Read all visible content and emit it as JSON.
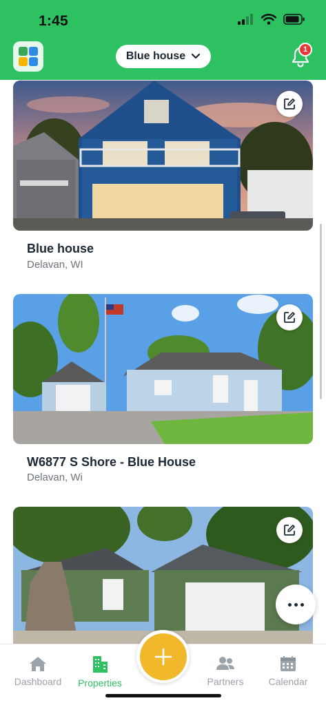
{
  "status_bar": {
    "time": "1:45",
    "icons": [
      "cellular-signal-icon",
      "wifi-icon",
      "battery-icon"
    ]
  },
  "header": {
    "property_selector": "Blue house",
    "notification_count": "1",
    "colors": {
      "header_bg": "#2ec162",
      "badge": "#e53935"
    }
  },
  "properties": [
    {
      "name": "Blue house",
      "location": "Delavan, WI"
    },
    {
      "name": "W6877 S Shore - Blue House",
      "location": "Delavan, Wi"
    },
    {
      "name": "",
      "location": ""
    }
  ],
  "bottom_nav": {
    "items": [
      {
        "label": "Dashboard",
        "icon": "home-icon",
        "active": false
      },
      {
        "label": "Properties",
        "icon": "building-icon",
        "active": true
      },
      {
        "label": "Partners",
        "icon": "people-icon",
        "active": false
      },
      {
        "label": "Calendar",
        "icon": "calendar-icon",
        "active": false
      }
    ],
    "fab_icon": "plus-icon",
    "colors": {
      "active": "#2ec162",
      "inactive": "#9aa2aa",
      "fab": "#f0b82a"
    }
  }
}
